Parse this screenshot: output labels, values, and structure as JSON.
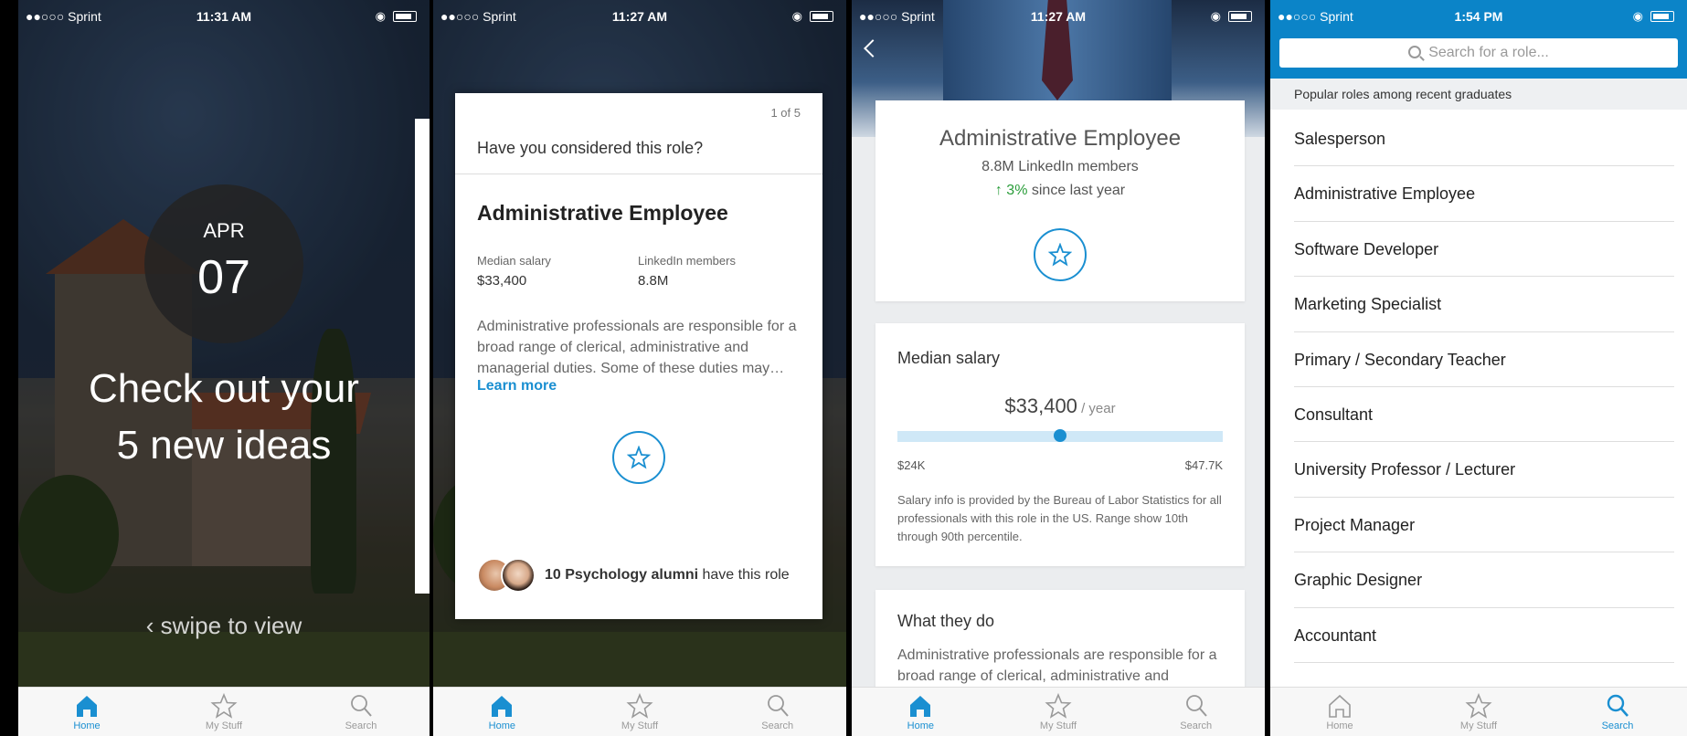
{
  "screens": [
    {
      "status": {
        "carrier": "●●○○○ Sprint",
        "time": "11:31 AM"
      },
      "date": {
        "month": "APR",
        "day": "07"
      },
      "headline": {
        "line1": "Check out your",
        "line2": "5 new ideas"
      },
      "swipe": "‹ swipe to view",
      "tabs": {
        "home": "Home",
        "my_stuff": "My Stuff",
        "search": "Search"
      }
    },
    {
      "status": {
        "carrier": "●●○○○ Sprint",
        "time": "11:27 AM"
      },
      "card": {
        "count": "1 of 5",
        "question": "Have you considered this role?",
        "role": "Administrative Employee",
        "salary_label": "Median salary",
        "salary_value": "$33,400",
        "members_label": "LinkedIn members",
        "members_value": "8.8M",
        "description": "Administrative professionals are responsible for a broad range of clerical, administrative and managerial duties. Some of these duties may…",
        "learn_more": "Learn more",
        "alumni_bold": "10 Psychology alumni",
        "alumni_rest": " have this role"
      },
      "tabs": {
        "home": "Home",
        "my_stuff": "My Stuff",
        "search": "Search"
      }
    },
    {
      "status": {
        "carrier": "●●○○○ Sprint",
        "time": "11:27 AM"
      },
      "role": {
        "title": "Administrative Employee",
        "members": "8.8M LinkedIn members",
        "growth_pct": "↑ 3%",
        "growth_rest": " since last year"
      },
      "salary": {
        "heading": "Median salary",
        "amount": "$33,400",
        "unit": " / year",
        "low": "$24K",
        "high": "$47.7K",
        "note": "Salary info is provided by the Bureau of Labor Statistics for all professionals with this role in the US. Range show 10th through 90th percentile."
      },
      "what": {
        "heading": "What they do",
        "text": "Administrative professionals are responsible for a broad range of clerical, administrative and"
      },
      "tabs": {
        "home": "Home",
        "my_stuff": "My Stuff",
        "search": "Search"
      }
    },
    {
      "status": {
        "carrier": "●●○○○ Sprint",
        "time": "1:54 PM"
      },
      "search_placeholder": "Search for a role...",
      "section": "Popular roles among recent graduates",
      "roles": [
        "Salesperson",
        "Administrative Employee",
        "Software Developer",
        "Marketing Specialist",
        "Primary / Secondary Teacher",
        "Consultant",
        "University Professor / Lecturer",
        "Project Manager",
        "Graphic Designer",
        "Accountant"
      ],
      "tabs": {
        "home": "Home",
        "my_stuff": "My Stuff",
        "search": "Search"
      }
    }
  ],
  "colors": {
    "accent": "#1a8fd1",
    "header_blue": "#0b84c8",
    "growth_green": "#2a9d3a"
  },
  "icons": [
    "home-icon",
    "star-icon",
    "search-icon",
    "back-chevron-icon"
  ]
}
